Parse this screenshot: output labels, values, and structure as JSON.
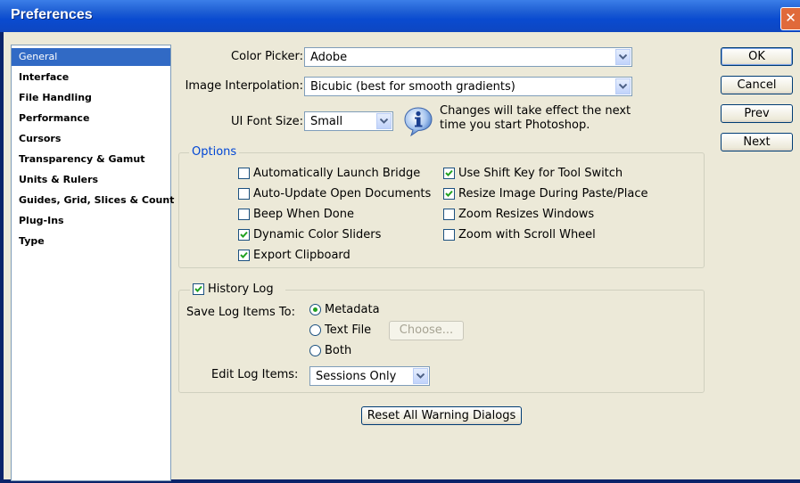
{
  "window": {
    "title": "Preferences"
  },
  "sidebar": {
    "items": [
      {
        "label": "General",
        "selected": true
      },
      {
        "label": "Interface"
      },
      {
        "label": "File Handling"
      },
      {
        "label": "Performance"
      },
      {
        "label": "Cursors"
      },
      {
        "label": "Transparency & Gamut"
      },
      {
        "label": "Units & Rulers"
      },
      {
        "label": "Guides, Grid, Slices & Count"
      },
      {
        "label": "Plug-Ins"
      },
      {
        "label": "Type"
      }
    ]
  },
  "general": {
    "color_picker": {
      "label": "Color Picker:",
      "value": "Adobe"
    },
    "image_interpolation": {
      "label": "Image Interpolation:",
      "value": "Bicubic (best for smooth gradients)"
    },
    "ui_font_size": {
      "label": "UI Font Size:",
      "value": "Small"
    },
    "restart_note": {
      "line1": "Changes will take effect the next",
      "line2": "time you start Photoshop."
    }
  },
  "options": {
    "title": "Options",
    "auto_launch_bridge": {
      "label": "Automatically Launch Bridge",
      "checked": false
    },
    "auto_update_docs": {
      "label": "Auto-Update Open Documents",
      "checked": false
    },
    "beep_when_done": {
      "label": "Beep When Done",
      "checked": false
    },
    "dynamic_color_sliders": {
      "label": "Dynamic Color Sliders",
      "checked": true
    },
    "export_clipboard": {
      "label": "Export Clipboard",
      "checked": true
    },
    "shift_key_tool_switch": {
      "label": "Use Shift Key for Tool Switch",
      "checked": true
    },
    "resize_image_paste": {
      "label": "Resize Image During Paste/Place",
      "checked": true
    },
    "zoom_resizes_windows": {
      "label": "Zoom Resizes Windows",
      "checked": false
    },
    "zoom_scroll_wheel": {
      "label": "Zoom with Scroll Wheel",
      "checked": false
    }
  },
  "history_log": {
    "label": "History Log",
    "checked": true,
    "save_to_label": "Save Log Items To:",
    "metadata": {
      "label": "Metadata",
      "selected": true
    },
    "text_file": {
      "label": "Text File",
      "selected": false
    },
    "both": {
      "label": "Both",
      "selected": false
    },
    "choose_button": "Choose...",
    "edit_label": "Edit Log Items:",
    "edit_value": "Sessions Only"
  },
  "buttons": {
    "ok": "OK",
    "cancel": "Cancel",
    "prev": "Prev",
    "next": "Next",
    "reset_warnings": "Reset All Warning Dialogs"
  },
  "colors": {
    "title_bar": "#1f5fd4",
    "selection": "#316ac5",
    "dialog_bg": "#ece9d8",
    "check_mark": "#21a121"
  }
}
